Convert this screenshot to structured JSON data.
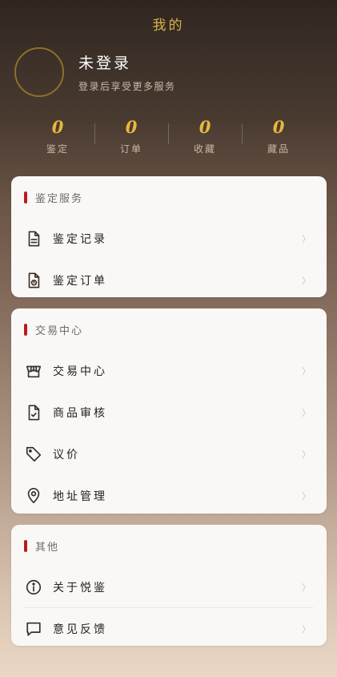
{
  "header": {
    "title": "我的"
  },
  "profile": {
    "name": "未登录",
    "subtitle": "登录后享受更多服务"
  },
  "stats": [
    {
      "value": "0",
      "label": "鉴定"
    },
    {
      "value": "0",
      "label": "订单"
    },
    {
      "value": "0",
      "label": "收藏"
    },
    {
      "value": "0",
      "label": "藏品"
    }
  ],
  "sections": {
    "appraisal": {
      "title": "鉴定服务",
      "items": [
        {
          "label": "鉴定记录",
          "icon": "document-lines-icon"
        },
        {
          "label": "鉴定订单",
          "icon": "document-seal-icon"
        }
      ]
    },
    "trade": {
      "title": "交易中心",
      "items": [
        {
          "label": "交易中心",
          "icon": "shop-icon"
        },
        {
          "label": "商品审核",
          "icon": "document-check-icon"
        },
        {
          "label": "议价",
          "icon": "tag-icon"
        },
        {
          "label": "地址管理",
          "icon": "location-pin-icon"
        }
      ]
    },
    "other": {
      "title": "其他",
      "items": [
        {
          "label": "关于悦鉴",
          "icon": "info-icon"
        },
        {
          "label": "意见反馈",
          "icon": "chat-bubble-icon"
        }
      ]
    }
  },
  "chevron": "〉",
  "colors": {
    "accent": "#e8b83c",
    "section_marker": "#b71c1c"
  }
}
